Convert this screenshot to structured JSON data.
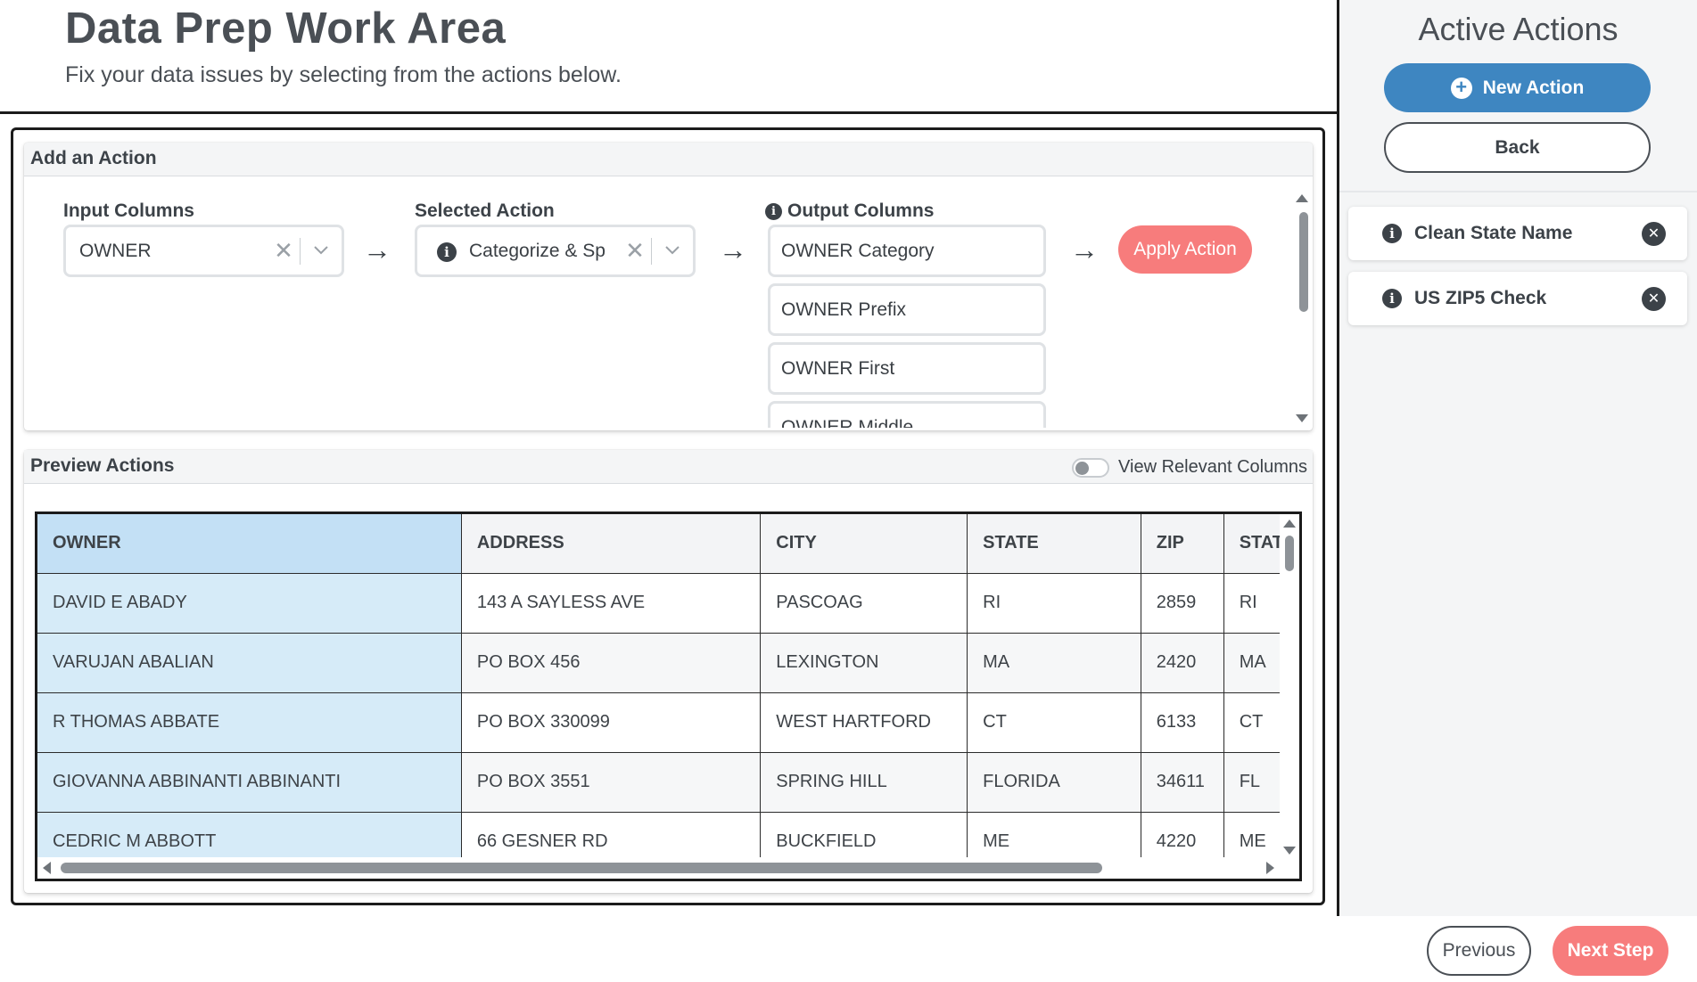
{
  "header": {
    "title": "Data Prep Work Area",
    "subtitle": "Fix your data issues by selecting from the actions below."
  },
  "add_action": {
    "title": "Add an Action",
    "input_columns_label": "Input Columns",
    "input_column_value": "OWNER",
    "selected_action_label": "Selected Action",
    "selected_action_value": "Categorize & Sp",
    "output_columns_label": "Output Columns",
    "output_columns": [
      "OWNER Category",
      "OWNER Prefix",
      "OWNER First",
      "OWNER Middle"
    ],
    "apply_label": "Apply Action",
    "clear_glyph": "✕",
    "chevron_glyph": "⌄",
    "arrow_glyph": "→",
    "info_glyph": "i"
  },
  "preview": {
    "title": "Preview Actions",
    "toggle_label": "View Relevant Columns",
    "toggle_on": false,
    "columns": [
      "OWNER",
      "ADDRESS",
      "CITY",
      "STATE",
      "ZIP",
      "STAT"
    ],
    "rows": [
      [
        "DAVID E ABADY",
        "143 A SAYLESS AVE",
        "PASCOAG",
        "RI",
        "2859",
        "RI"
      ],
      [
        "VARUJAN ABALIAN",
        "PO BOX 456",
        "LEXINGTON",
        "MA",
        "2420",
        "MA"
      ],
      [
        "R THOMAS ABBATE",
        "PO BOX 330099",
        "WEST HARTFORD",
        "CT",
        "6133",
        "CT"
      ],
      [
        "GIOVANNA ABBINANTI ABBINANTI",
        "PO BOX 3551",
        "SPRING HILL",
        "FLORIDA",
        "34611",
        "FL"
      ],
      [
        "CEDRIC M ABBOTT",
        "66 GESNER RD",
        "BUCKFIELD",
        "ME",
        "4220",
        "ME"
      ]
    ]
  },
  "sidebar": {
    "title": "Active Actions",
    "new_action_label": "New Action",
    "plus_glyph": "+",
    "back_label": "Back",
    "actions": [
      {
        "label": "Clean State Name"
      },
      {
        "label": "US ZIP5 Check"
      }
    ],
    "remove_glyph": "✕"
  },
  "footer": {
    "previous_label": "Previous",
    "next_label": "Next Step"
  },
  "colors": {
    "primary": "#3e86c1",
    "accent": "#f77c7c",
    "highlight_column": "#d6ebf8"
  }
}
